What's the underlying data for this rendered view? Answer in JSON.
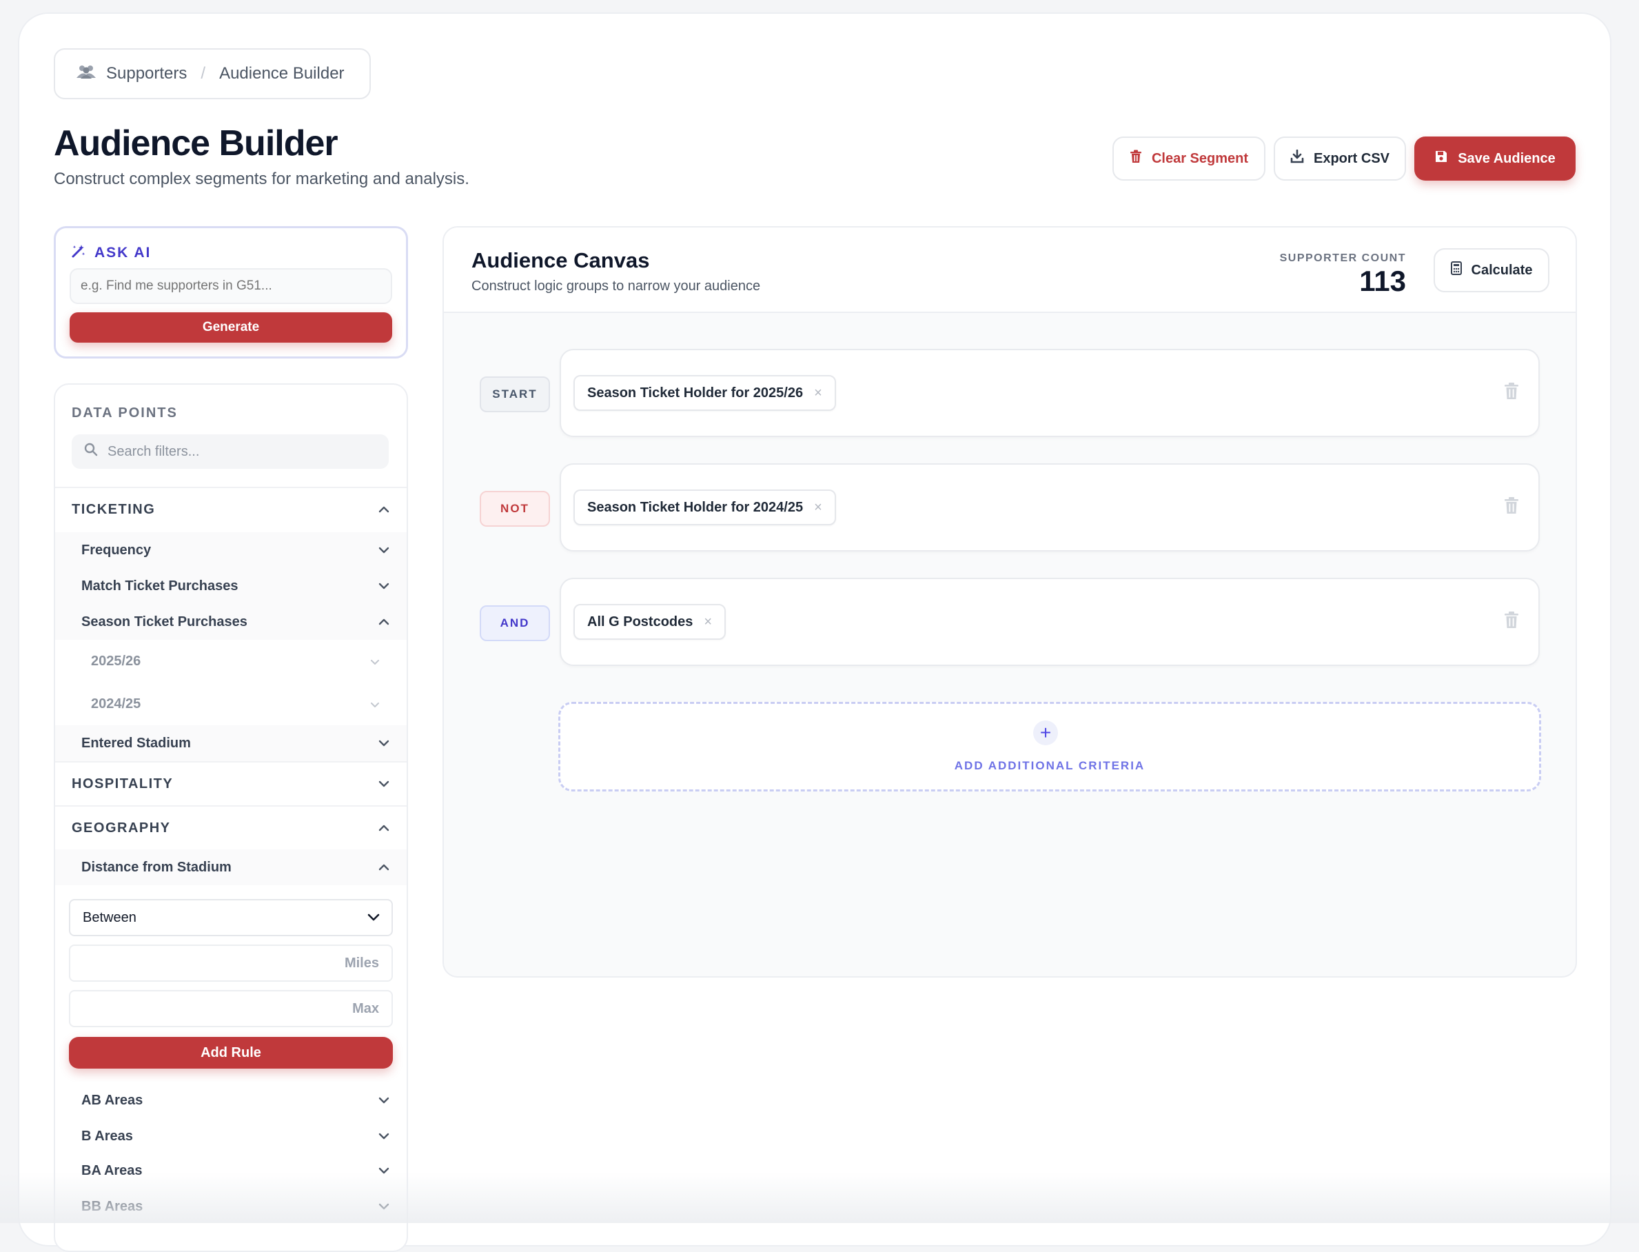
{
  "breadcrumb": {
    "root": "Supporters",
    "separator": "/",
    "current": "Audience Builder"
  },
  "header": {
    "title": "Audience Builder",
    "subtitle": "Construct complex segments for marketing and analysis.",
    "clear_label": "Clear Segment",
    "export_label": "Export CSV",
    "save_label": "Save Audience"
  },
  "ask_ai": {
    "label": "ASK AI",
    "placeholder": "e.g. Find me supporters in G51...",
    "button": "Generate"
  },
  "data_points": {
    "title": "DATA POINTS",
    "search_placeholder": "Search filters...",
    "ticketing": "TICKETING",
    "frequency": "Frequency",
    "match_ticket": "Match Ticket Purchases",
    "season_ticket": "Season Ticket Purchases",
    "season_2526": "2025/26",
    "season_2425": "2024/25",
    "entered_stadium": "Entered Stadium",
    "hospitality": "HOSPITALITY",
    "geography": "GEOGRAPHY",
    "distance": "Distance from Stadium",
    "operator_value": "Between",
    "miles_placeholder": "Miles",
    "max_placeholder": "Max",
    "add_rule": "Add Rule",
    "ab_areas": "AB Areas",
    "b_areas": "B Areas",
    "ba_areas": "BA Areas",
    "bb_areas": "BB Areas"
  },
  "canvas": {
    "title": "Audience Canvas",
    "subtitle": "Construct logic groups to narrow your audience",
    "count_label": "SUPPORTER COUNT",
    "count_value": "113",
    "calculate": "Calculate",
    "rules": [
      {
        "operator": "START",
        "chip": "Season Ticket Holder for 2025/26"
      },
      {
        "operator": "NOT",
        "chip": "Season Ticket Holder for 2024/25"
      },
      {
        "operator": "AND",
        "chip": "All G Postcodes"
      }
    ],
    "add_label": "ADD ADDITIONAL CRITERIA"
  },
  "colors": {
    "brand_red": "#c0393b",
    "accent_indigo": "#4338ca",
    "text_dark": "#0f172a"
  },
  "icons": [
    "users-icon",
    "trash-icon",
    "download-icon",
    "save-icon",
    "magic-wand-icon",
    "search-icon",
    "chevron-up-icon",
    "chevron-down-icon",
    "calculator-icon",
    "close-icon",
    "plus-icon"
  ]
}
